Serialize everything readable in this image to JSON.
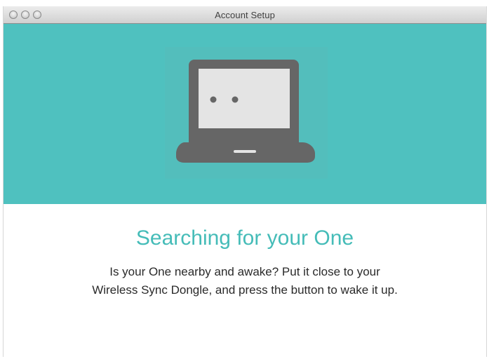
{
  "window": {
    "title": "Account Setup",
    "controls": [
      "close-button",
      "minimize-button",
      "zoom-button"
    ]
  },
  "hero": {
    "background_color": "#4fc1bf",
    "illustration": "laptop-with-face-icon"
  },
  "main": {
    "headline": "Searching for your One",
    "body_line_1": "Is your One nearby and awake? Put it close to your",
    "body_line_2": "Wireless Sync Dongle, and press the button to wake it up."
  },
  "colors": {
    "accent": "#45bcb8",
    "laptop_body": "#666666",
    "laptop_screen": "#e4e4e4",
    "text": "#2a2a2a"
  }
}
